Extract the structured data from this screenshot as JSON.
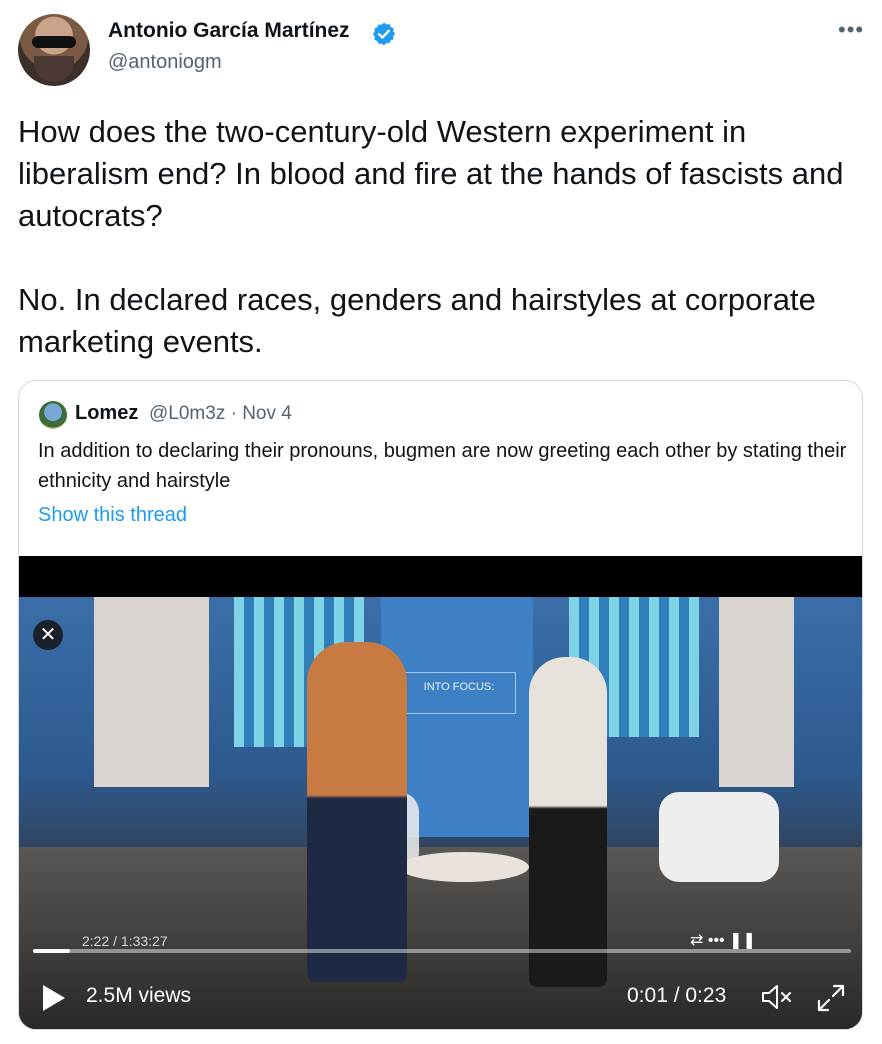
{
  "tweet": {
    "author_name": "Antonio García Martínez",
    "author_handle": "@antoniogm",
    "verified_icon": "verified-badge-icon",
    "more_icon": "more-horizontal-icon",
    "more_label": "•••",
    "text": "How does the two-century-old Western experiment in liberalism end? In blood and fire at the hands of fascists and autocrats?\n\nNo. In declared races, genders and hairstyles at corporate marketing events."
  },
  "quote": {
    "author_name": "Lomez",
    "meta": "@L0m3z · Nov 4",
    "text": "In addition to declaring their pronouns, bugmen are now greeting each other by stating their ethnicity and hairstyle",
    "thread_link": "Show this thread"
  },
  "video": {
    "sign_text": "INTO FOCUS:",
    "close_label": "✕",
    "inner_time": "2:22 / 1:33:27",
    "inner_icons_label": "⇄  •••  ❚❚",
    "views": "2.5M views",
    "time": "0:01 / 0:23",
    "progress_fraction": 0.045
  },
  "colors": {
    "accent": "#1d9bf0",
    "text_primary": "#0f1419",
    "text_secondary": "#536471",
    "border": "#cfd9de"
  }
}
